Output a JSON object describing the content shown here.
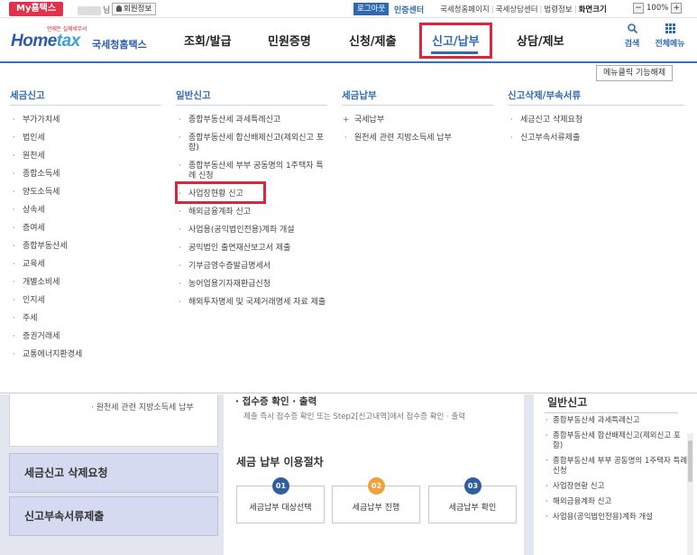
{
  "topbar": {
    "my_hometax": "My홈택스",
    "user_suffix": "님",
    "member_info": "회원정보",
    "logout": "로그아웃",
    "auth_center": "인증센터",
    "links": [
      "국세청홈페이지",
      "국세상담센터",
      "법령정보"
    ],
    "screen_size": "화면크기",
    "zoom_minus": "−",
    "zoom_value": "100%",
    "zoom_plus": "+"
  },
  "header": {
    "logo_tagline": "언제든 실제세무서",
    "logo_home": "Home",
    "logo_tax": "tax",
    "logo_kr": "국세청홈택스",
    "nav": [
      "조회/발급",
      "민원증명",
      "신청/제출",
      "신고/납부",
      "상담/제보"
    ],
    "search": "검색",
    "all_menu": "전체메뉴"
  },
  "mega_menu": {
    "close_click": "메뉴클릭 기능해제",
    "columns": [
      {
        "title": "세금신고",
        "items": [
          "부가가치세",
          "법인세",
          "원천세",
          "종합소득세",
          "양도소득세",
          "상속세",
          "증여세",
          "종합부동산세",
          "교육세",
          "개별소비세",
          "인지세",
          "주세",
          "증권거래세",
          "교통에너지환경세"
        ]
      },
      {
        "title": "일반신고",
        "items": [
          "종합부동산세 과세특례신고",
          "종합부동산세 합산배제신고(제외신고 포함)",
          "종합부동산세 부부 공동명의 1주택자 특례 신청",
          "사업장현황 신고",
          "해외금융계좌 신고",
          "사업용(공익법인전용)계좌 개설",
          "공익법인 출연재산보고서 제출",
          "기부금영수증발급명세서",
          "농어업용기자재환급신청",
          "해외투자명세 및 국제거래명세 자료 제출"
        ]
      },
      {
        "title": "세금납부",
        "items": [
          "국세납부",
          "원천세 관련 지방소득세 납부"
        ]
      },
      {
        "title": "신고삭제/부속서류",
        "items": [
          "세금신고 삭제요청",
          "신고부속서류제출"
        ]
      }
    ]
  },
  "lower": {
    "left_text": "원천세 관련 지방소득세 납부",
    "side_buttons": [
      "세금신고 삭제요청",
      "신고부속서류제출"
    ],
    "receipt_title": "접수증 확인 · 출력",
    "receipt_desc": "제출 즉시 접수증 확인 또는 Step2[신고내역]에서 접수증 확인 · 출력",
    "process_title": "세금 납부 이용절차",
    "steps": [
      {
        "num": "01",
        "label": "세금납부 대상선택",
        "color": "#2f5f9e"
      },
      {
        "num": "02",
        "label": "세금납부 진행",
        "color": "#f0a23a"
      },
      {
        "num": "03",
        "label": "세금납부 확인",
        "color": "#2f5f9e"
      }
    ],
    "right_title": "일반신고",
    "right_items": [
      "종합부동산세 과세특례신고",
      "종합부동산세 합산배제신고(제외신고 포함)",
      "종합부동산세 부부 공동명의 1주택자 특례 신청",
      "사업장현황 신고",
      "해외금융계좌 신고",
      "사업용(공익법인전용)계좌 개설"
    ]
  }
}
